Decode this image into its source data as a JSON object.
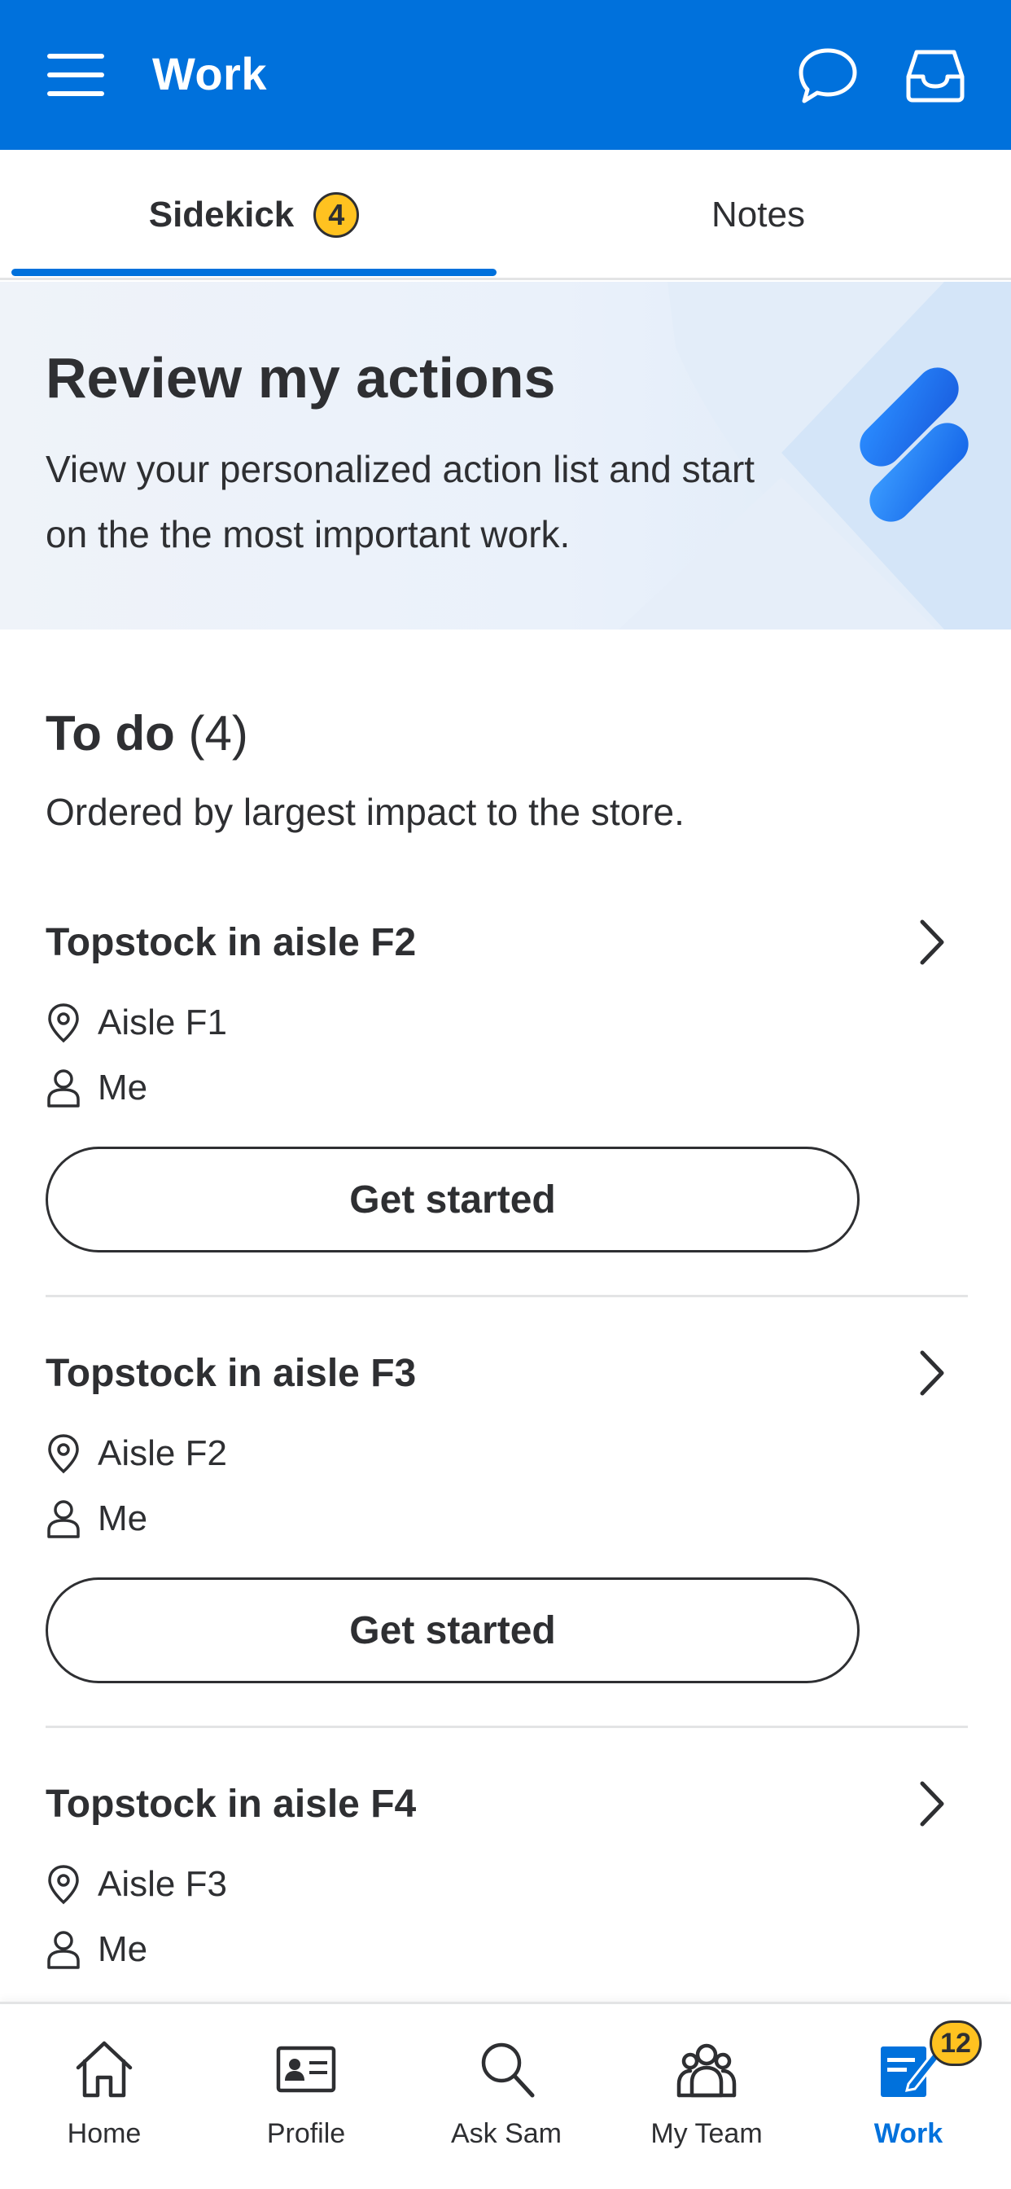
{
  "header": {
    "title": "Work",
    "menu_icon": "hamburger-menu-icon",
    "chat_icon": "chat-bubble-icon",
    "inbox_icon": "inbox-tray-icon"
  },
  "tabs": [
    {
      "label": "Sidekick",
      "badge": "4",
      "active": true
    },
    {
      "label": "Notes",
      "active": false
    }
  ],
  "banner": {
    "title": "Review my actions",
    "text": "View your personalized action list and start on the the most important work.",
    "logo_icon": "sidekick-logo-icon"
  },
  "todo": {
    "title": "To do",
    "count": "(4)",
    "subtitle": "Ordered by largest impact to the store."
  },
  "tasks": [
    {
      "title": "Topstock in aisle F2",
      "location": "Aisle F1",
      "assignee": "Me",
      "button": "Get started"
    },
    {
      "title": "Topstock in aisle F3",
      "location": "Aisle F2",
      "assignee": "Me",
      "button": "Get started"
    },
    {
      "title": "Topstock in aisle F4",
      "location": "Aisle F3",
      "assignee": "Me"
    }
  ],
  "bottom_nav": [
    {
      "label": "Home",
      "icon": "home-icon"
    },
    {
      "label": "Profile",
      "icon": "profile-card-icon"
    },
    {
      "label": "Ask Sam",
      "icon": "search-icon"
    },
    {
      "label": "My Team",
      "icon": "team-icon"
    },
    {
      "label": "Work",
      "icon": "work-clipboard-icon",
      "badge": "12",
      "active": true
    }
  ],
  "colors": {
    "brand_blue": "#0071dc",
    "badge_yellow": "#ffc220",
    "text": "#2e2f32"
  }
}
